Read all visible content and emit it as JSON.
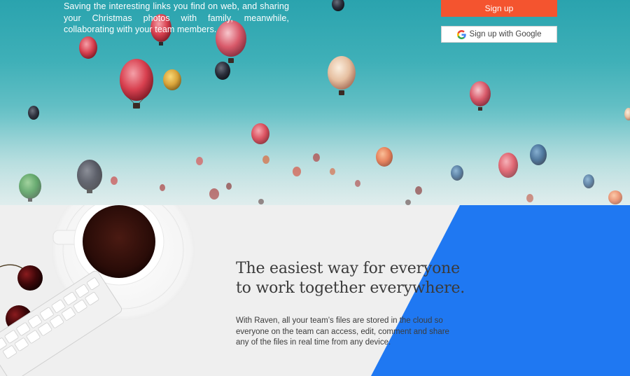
{
  "hero": {
    "description": "Saving the interesting links you find on web, and sharing your Christmas photos with family, meanwhile, collaborating with your team members.",
    "signup_label": "Sign up",
    "google_signup_label": "Sign up with Google"
  },
  "feature": {
    "headline_line1": "The easiest way for everyone",
    "headline_line2": "to work together everywhere.",
    "description": "With Raven, all your team’s files are stored in the cloud so everyone on the team can access, edit, comment and share any of the files in real time from any device."
  },
  "colors": {
    "accent_orange": "#f4542f",
    "accent_blue": "#1f78f2",
    "sky_top": "#2aa3ae",
    "feature_bg": "#efefef"
  },
  "icons": {
    "google": "google-icon"
  }
}
